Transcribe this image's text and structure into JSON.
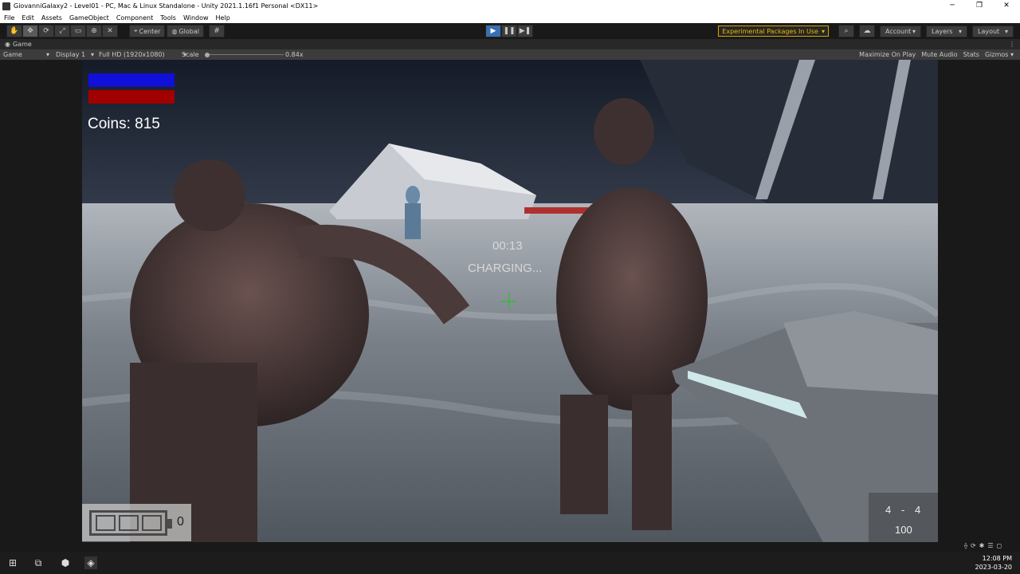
{
  "window": {
    "title": "GiovanniGalaxy2 - Level01 - PC, Mac & Linux Standalone - Unity 2021.1.16f1 Personal <DX11>",
    "minimize": "─",
    "restore": "❐",
    "close": "✕"
  },
  "menu": {
    "items": [
      "File",
      "Edit",
      "Assets",
      "GameObject",
      "Component",
      "Tools",
      "Window",
      "Help"
    ]
  },
  "toolbar": {
    "pivot_label": "Center",
    "space_label": "Global",
    "experimental_label": "Experimental Packages In Use",
    "account_label": "Account",
    "layers_label": "Layers",
    "layout_label": "Layout"
  },
  "game_tab": {
    "label": "Game",
    "view_select": "Game",
    "display_select": "Display 1",
    "resolution_select": "Full HD (1920x1080)",
    "scale_label": "Scale",
    "scale_value": "0.84x",
    "scale_fraction": 0.03,
    "maximize_label": "Maximize On Play",
    "mute_label": "Mute Audio",
    "stats_label": "Stats",
    "gizmos_label": "Gizmos"
  },
  "hud": {
    "health_color": "#1010d8",
    "shield_color": "#a00000",
    "coins_text": "Coins: 815",
    "timer_text": "00:13",
    "charging_text": "CHARGING...",
    "battery_count": "0",
    "ammo_clip": "4",
    "ammo_sep": "-",
    "ammo_mag": "4",
    "ammo_reserve": "100"
  },
  "taskbar": {
    "time": "12:08 PM",
    "date": "2023-03-20"
  }
}
